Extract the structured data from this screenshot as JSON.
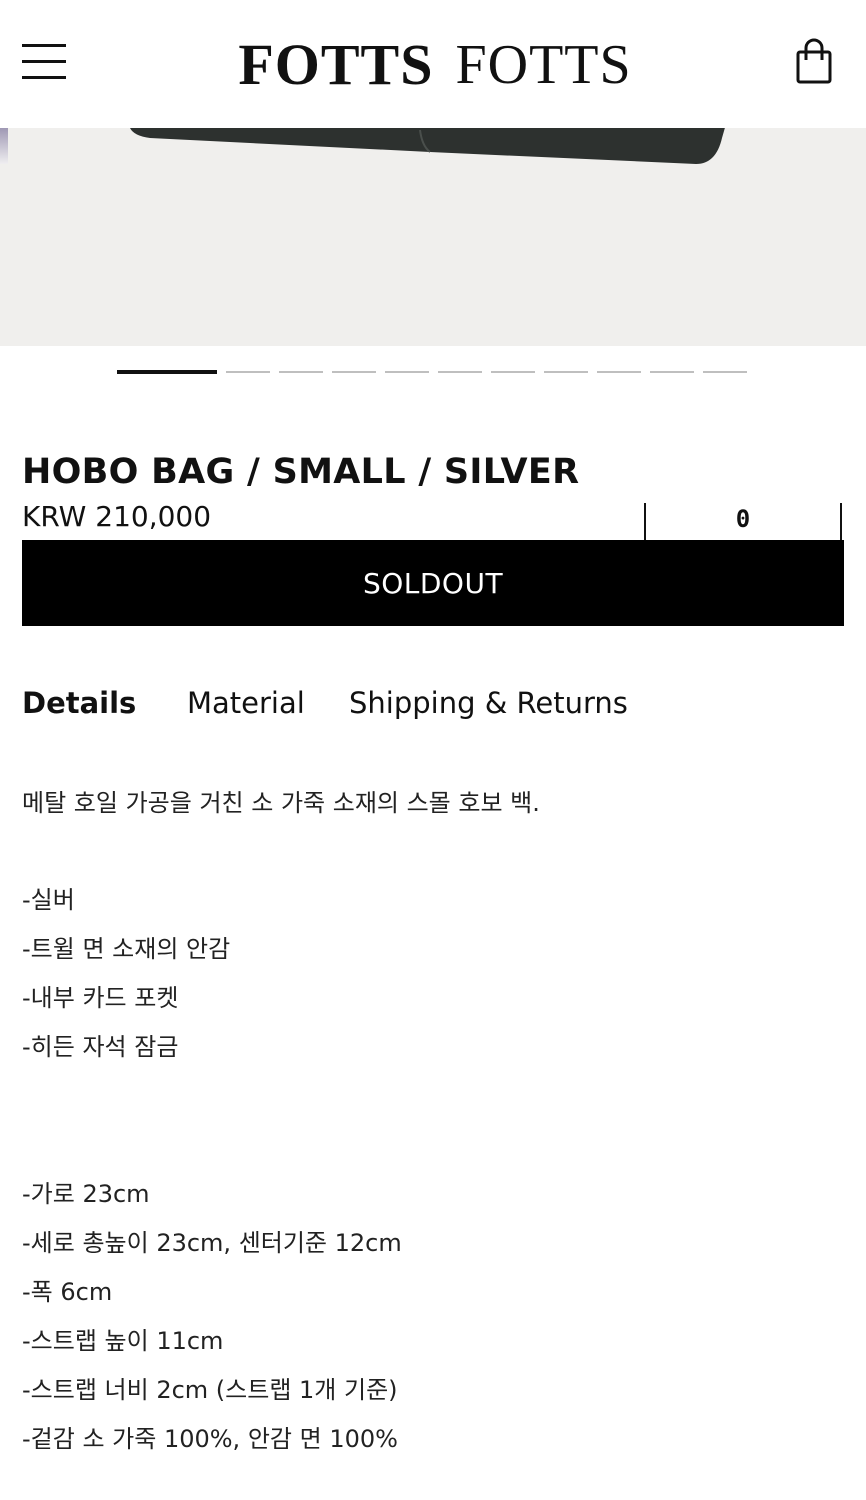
{
  "header": {
    "menu_icon": "hamburger-menu-icon",
    "logo_word_1": "FOTTS",
    "logo_word_2": "FOTTS",
    "cart_icon": "shopping-bag-icon"
  },
  "gallery": {
    "slide_count": 11,
    "active_index": 0
  },
  "product": {
    "title": "HOBO BAG / SMALL / SILVER",
    "price": "KRW 210,000",
    "quantity": "0",
    "button_label": "SOLDOUT"
  },
  "tabs": [
    {
      "label": "Details",
      "active": true
    },
    {
      "label": "Material",
      "active": false
    },
    {
      "label": "Shipping & Returns",
      "active": false
    }
  ],
  "details": {
    "intro": "메탈 호일 가공을 거친 소 가죽 소재의 스몰 호보 백.",
    "features": [
      "-실버",
      "-트윌 면 소재의 안감",
      "-내부 카드 포켓",
      "-히든 자석 잠금"
    ],
    "specs": [
      "-가로 23cm",
      "-세로 총높이 23cm, 센터기준 12cm",
      "-폭 6cm",
      "-스트랩 높이 11cm",
      "-스트랩 너비 2cm (스트랩 1개 기준)",
      "-겉감 소 가죽 100%, 안감 면 100%"
    ]
  },
  "colors": {
    "text": "#111111",
    "button_bg": "#000000",
    "button_text": "#ffffff",
    "hero_bg": "#f0efed",
    "inactive_dot": "#bfbfbf"
  }
}
